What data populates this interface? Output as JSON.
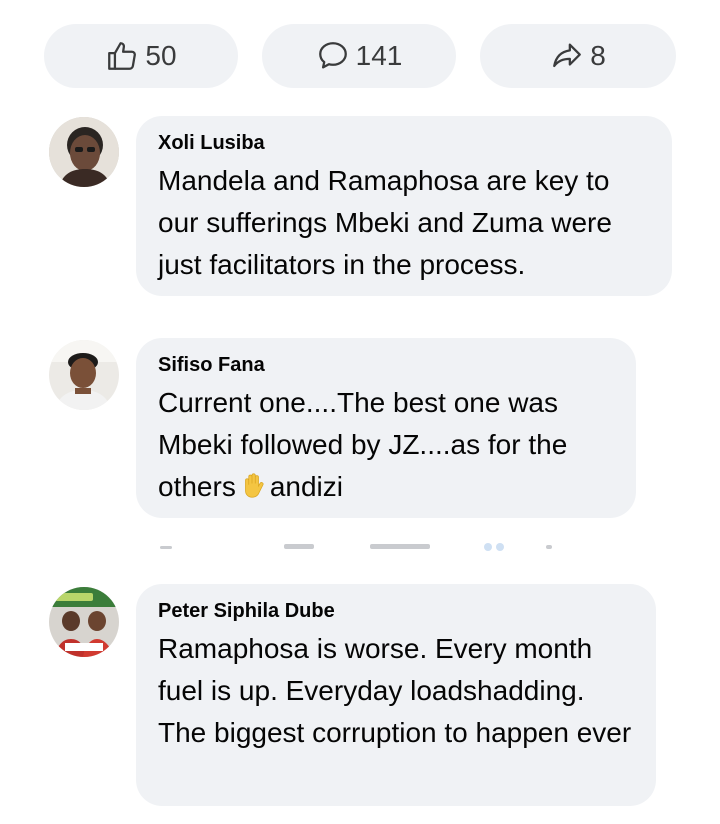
{
  "reactions": {
    "likes": "50",
    "comments": "141",
    "shares": "8"
  },
  "comments": [
    {
      "author": "Xoli Lusiba",
      "text": "Mandela and Ramaphosa are key to our sufferings Mbeki and Zuma were just facilitators in the process."
    },
    {
      "author": "Sifiso Fana",
      "text_before": "Current one....The best one was Mbeki followed by JZ....as for the others",
      "emoji": "raised-hand",
      "text_after": "andizi"
    },
    {
      "author": "Peter Siphila Dube",
      "text": "Ramaphosa is worse. Every month fuel is up. Everyday loadshadding. The biggest corruption to happen ever"
    }
  ],
  "colors": {
    "bubble": "#f0f2f5",
    "text": "#050505",
    "emoji": "#f4c542"
  }
}
